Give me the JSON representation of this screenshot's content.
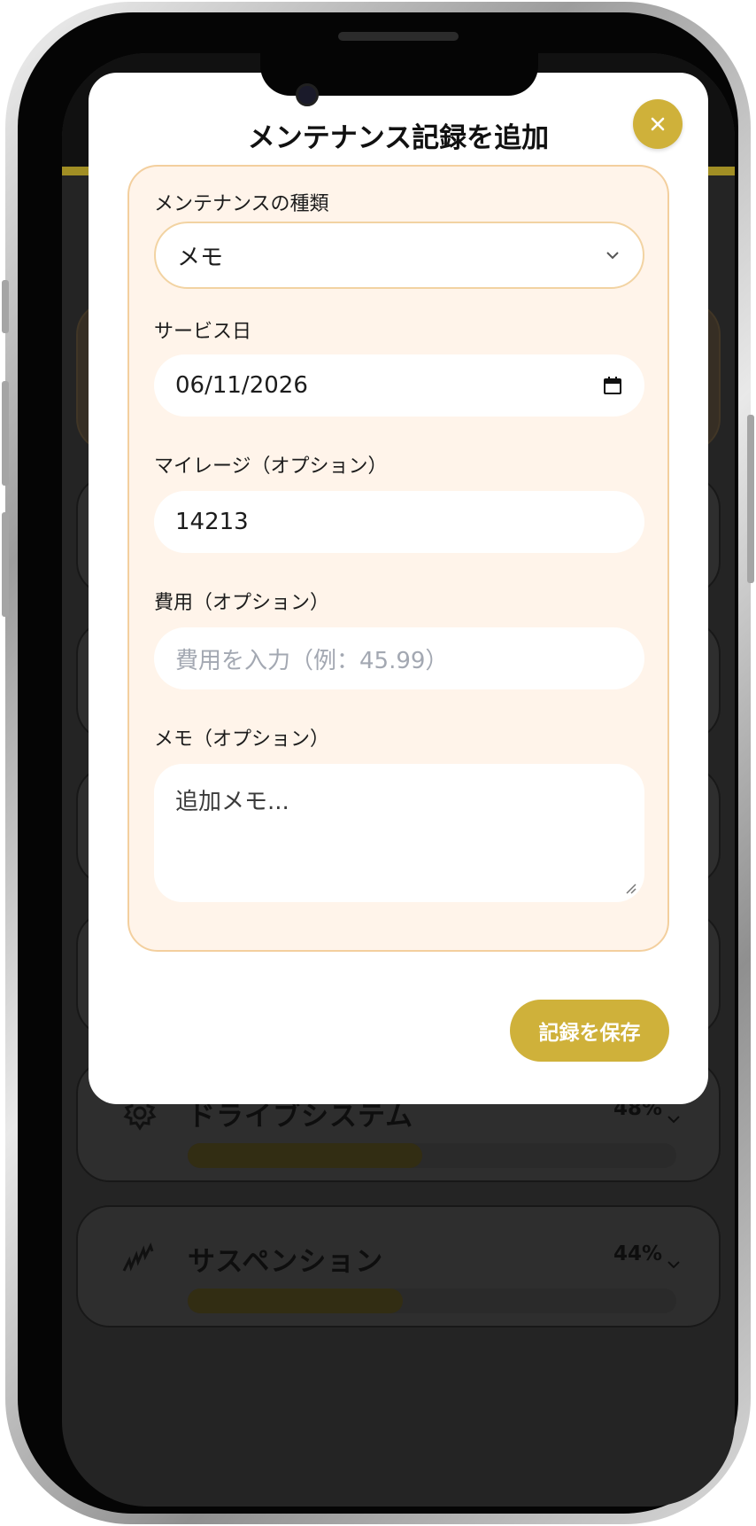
{
  "modal": {
    "title": "メンテナンス記録を追加",
    "close_label": "×",
    "fields": {
      "type_label": "メンテナンスの種類",
      "type_value": "メモ",
      "date_label": "サービス日",
      "date_value": "06/11/2026",
      "mileage_label": "マイレージ（オプション）",
      "mileage_value": "14213",
      "cost_label": "費用（オプション）",
      "cost_placeholder": "費用を入力（例：45.99）",
      "notes_label": "メモ（オプション）",
      "notes_placeholder": "追加メモ..."
    },
    "save_label": "記録を保存"
  },
  "background": {
    "cards": [
      {
        "title": "ドライブシステム",
        "percent": "48%",
        "progress": 0.48,
        "icon": "gear-icon"
      },
      {
        "title": "サスペンション",
        "percent": "44%",
        "progress": 0.44,
        "icon": "spring-icon"
      }
    ]
  },
  "colors": {
    "accent": "#cfb13a",
    "panel_bg": "#fff4ea",
    "panel_border": "#f3cf9e",
    "placeholder": "#a3a8b2"
  }
}
